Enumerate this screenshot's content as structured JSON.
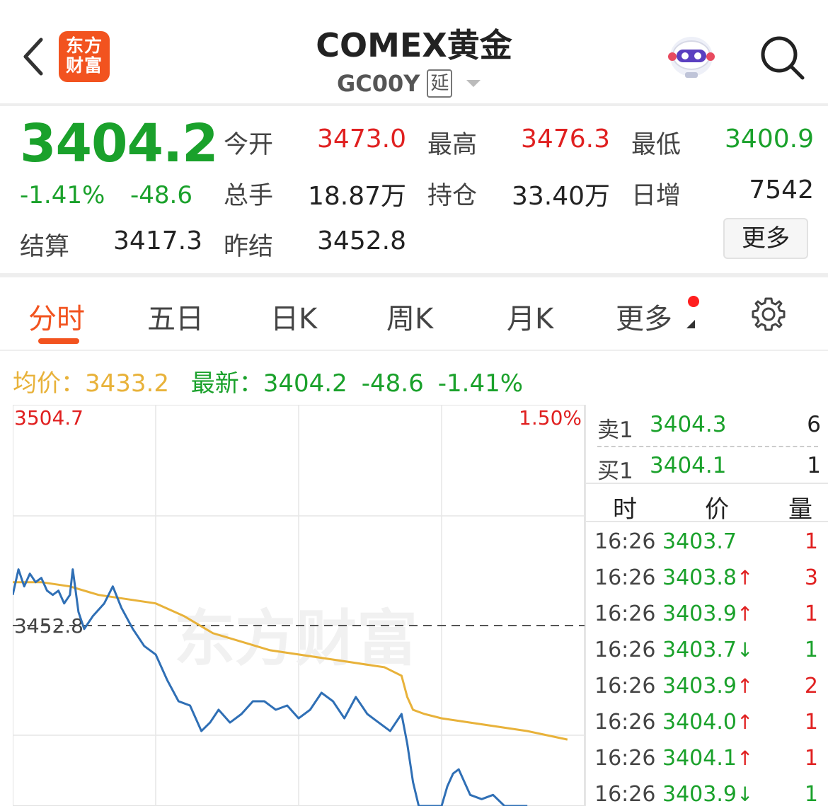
{
  "header": {
    "logo_text": "东方财富",
    "title": "COMEX黄金",
    "code": "GC00Y",
    "delay_tag": "延"
  },
  "quote": {
    "price": "3404.2",
    "change_pct": "-1.41%",
    "change": "-48.6",
    "open_label": "今开",
    "open": "3473.0",
    "high_label": "最高",
    "high": "3476.3",
    "low_label": "最低",
    "low": "3400.9",
    "volume_label": "总手",
    "volume": "18.87万",
    "oi_label": "持仓",
    "oi": "33.40万",
    "daily_inc_label": "日增",
    "daily_inc": "7542",
    "settle_label": "结算",
    "settle": "3417.3",
    "prev_settle_label": "昨结",
    "prev_settle": "3452.8",
    "more_label": "更多"
  },
  "tabs": [
    {
      "label": "分时",
      "active": true
    },
    {
      "label": "五日",
      "active": false
    },
    {
      "label": "日K",
      "active": false
    },
    {
      "label": "周K",
      "active": false
    },
    {
      "label": "月K",
      "active": false
    },
    {
      "label": "更多",
      "active": false
    }
  ],
  "avg_row": {
    "avg_label": "均价：",
    "avg_value": "3433.2",
    "latest_label": "最新：",
    "latest_value": "3404.2",
    "latest_change": "-48.6",
    "latest_pct": "-1.41%"
  },
  "chart_data": {
    "type": "line",
    "y_top_label": "3504.7",
    "y_top_pct": "1.50%",
    "ref_label": "3452.8",
    "watermark": "东方财富",
    "ylim": [
      3400.9,
      3504.7
    ],
    "reference": 3452.8,
    "series": [
      {
        "points": [
          [
            0.0,
            3460
          ],
          [
            0.01,
            3466
          ],
          [
            0.02,
            3462
          ],
          [
            0.03,
            3465
          ],
          [
            0.04,
            3463
          ],
          [
            0.05,
            3464
          ],
          [
            0.06,
            3461
          ],
          [
            0.07,
            3460
          ],
          [
            0.08,
            3461
          ],
          [
            0.09,
            3458
          ],
          [
            0.1,
            3460
          ],
          [
            0.105,
            3466
          ],
          [
            0.115,
            3456
          ],
          [
            0.125,
            3452
          ],
          [
            0.14,
            3455
          ],
          [
            0.16,
            3458
          ],
          [
            0.175,
            3462
          ],
          [
            0.19,
            3457
          ],
          [
            0.21,
            3452
          ],
          [
            0.23,
            3448
          ],
          [
            0.25,
            3446
          ],
          [
            0.27,
            3440
          ],
          [
            0.29,
            3435
          ],
          [
            0.31,
            3434
          ],
          [
            0.33,
            3428
          ],
          [
            0.345,
            3430
          ],
          [
            0.36,
            3433
          ],
          [
            0.38,
            3430
          ],
          [
            0.4,
            3432
          ],
          [
            0.42,
            3435
          ],
          [
            0.44,
            3435
          ],
          [
            0.46,
            3433
          ],
          [
            0.48,
            3434
          ],
          [
            0.5,
            3431
          ],
          [
            0.52,
            3433
          ],
          [
            0.54,
            3437
          ],
          [
            0.56,
            3435
          ],
          [
            0.58,
            3431
          ],
          [
            0.6,
            3436
          ],
          [
            0.62,
            3432
          ],
          [
            0.64,
            3430
          ],
          [
            0.66,
            3428
          ],
          [
            0.68,
            3432
          ],
          [
            0.69,
            3425
          ],
          [
            0.7,
            3416
          ],
          [
            0.71,
            3401
          ],
          [
            0.715,
            3408
          ],
          [
            0.73,
            3404
          ],
          [
            0.75,
            3408
          ],
          [
            0.76,
            3415
          ],
          [
            0.77,
            3418
          ],
          [
            0.78,
            3419
          ],
          [
            0.8,
            3413
          ],
          [
            0.82,
            3412
          ],
          [
            0.84,
            3413
          ],
          [
            0.86,
            3410
          ],
          [
            0.88,
            3405
          ],
          [
            0.89,
            3402
          ],
          [
            0.9,
            3401
          ]
        ]
      },
      {
        "points": [
          [
            0.0,
            3463
          ],
          [
            0.05,
            3463
          ],
          [
            0.1,
            3462
          ],
          [
            0.15,
            3460
          ],
          [
            0.2,
            3459
          ],
          [
            0.25,
            3458
          ],
          [
            0.3,
            3455
          ],
          [
            0.35,
            3451
          ],
          [
            0.4,
            3449
          ],
          [
            0.45,
            3447
          ],
          [
            0.5,
            3446
          ],
          [
            0.55,
            3445
          ],
          [
            0.6,
            3444
          ],
          [
            0.65,
            3443
          ],
          [
            0.68,
            3441
          ],
          [
            0.69,
            3436
          ],
          [
            0.7,
            3433
          ],
          [
            0.72,
            3432
          ],
          [
            0.75,
            3431
          ],
          [
            0.8,
            3430
          ],
          [
            0.85,
            3429
          ],
          [
            0.9,
            3428
          ],
          [
            0.97,
            3426
          ]
        ]
      }
    ]
  },
  "order_book": {
    "sell_label": "卖1",
    "sell_price": "3404.3",
    "sell_qty": "6",
    "buy_label": "买1",
    "buy_price": "3404.1",
    "buy_qty": "1"
  },
  "ticks_header": {
    "time": "时",
    "price": "价",
    "vol": "量"
  },
  "ticks": [
    {
      "time": "16:26",
      "price": "3403.7",
      "arrow": "",
      "vol": "1"
    },
    {
      "time": "16:26",
      "price": "3403.8",
      "arrow": "↑",
      "vol": "3"
    },
    {
      "time": "16:26",
      "price": "3403.9",
      "arrow": "↑",
      "vol": "1"
    },
    {
      "time": "16:26",
      "price": "3403.7",
      "arrow": "↓",
      "vol": "1"
    },
    {
      "time": "16:26",
      "price": "3403.9",
      "arrow": "↑",
      "vol": "2"
    },
    {
      "time": "16:26",
      "price": "3404.0",
      "arrow": "↑",
      "vol": "1"
    },
    {
      "time": "16:26",
      "price": "3404.1",
      "arrow": "↑",
      "vol": "1"
    },
    {
      "time": "16:26",
      "price": "3403.9",
      "arrow": "↓",
      "vol": "1"
    }
  ],
  "colors": {
    "up": "#e02020",
    "down": "#1aa12b",
    "accent": "#f2531f",
    "avg_line": "#e8b23a",
    "price_line": "#2f6fb5"
  }
}
